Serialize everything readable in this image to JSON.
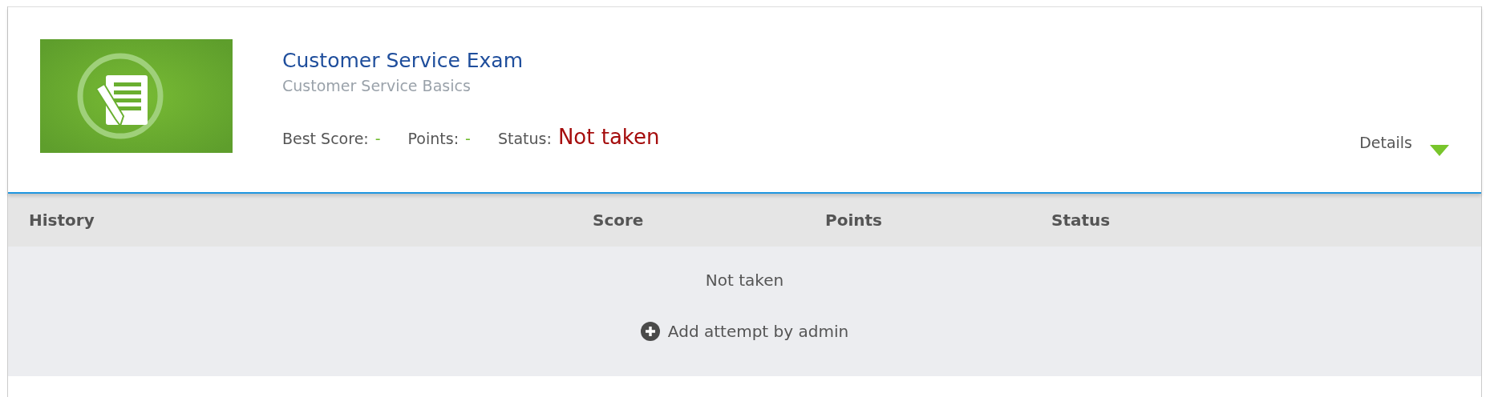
{
  "exam": {
    "title": "Customer Service Exam",
    "course": "Customer Service Basics",
    "stats": [
      {
        "label": "Best Score:",
        "value": "-",
        "kind": "dash"
      },
      {
        "label": "Points:",
        "value": "-",
        "kind": "dash"
      },
      {
        "label": "Status:",
        "value": "Not taken",
        "kind": "status"
      }
    ],
    "details": {
      "label": "Details",
      "expanded": false
    }
  },
  "history": {
    "columns": [
      "History",
      "Score",
      "Points",
      "Status"
    ],
    "empty_message": "Not taken",
    "add_button": "Add attempt by admin"
  }
}
